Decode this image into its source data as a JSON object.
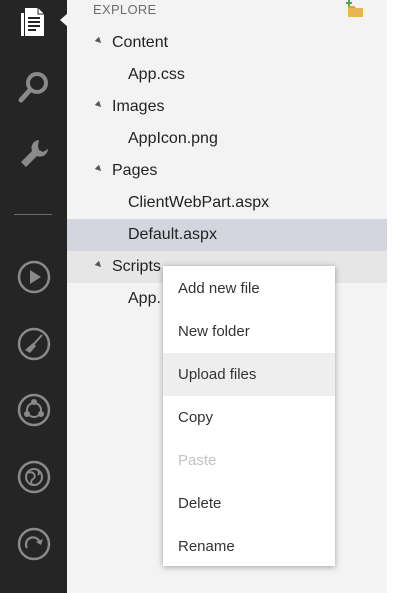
{
  "explorer": {
    "title": "EXPLORE",
    "tree": {
      "content": {
        "label": "Content",
        "files": [
          "App.css"
        ]
      },
      "images": {
        "label": "Images",
        "files": [
          "AppIcon.png"
        ]
      },
      "pages": {
        "label": "Pages",
        "files": [
          "ClientWebPart.aspx",
          "Default.aspx"
        ]
      },
      "scripts": {
        "label": "Scripts",
        "files_partial": [
          "App."
        ]
      }
    },
    "selected_file": "Default.aspx"
  },
  "activity_bar": {
    "icons": [
      "explore-icon",
      "search-icon",
      "wrench-icon",
      "run-icon",
      "broom-icon",
      "team-icon",
      "globe-icon",
      "redo-icon"
    ]
  },
  "context_menu": {
    "items": [
      "Add new file",
      "New folder",
      "Upload files",
      "Copy",
      "Paste",
      "Delete",
      "Rename"
    ],
    "hovered_item": "Upload files",
    "disabled_item": "Paste"
  },
  "colors": {
    "activity_bar": "#252526",
    "explorer_bg": "#f3f3f3",
    "selected_row": "#d3d6de",
    "hover_row": "#e6e6e6",
    "menu_disabled": "#c3c3c3",
    "folder_accent": "#d9a441",
    "folder_plus": "#54a35a"
  }
}
